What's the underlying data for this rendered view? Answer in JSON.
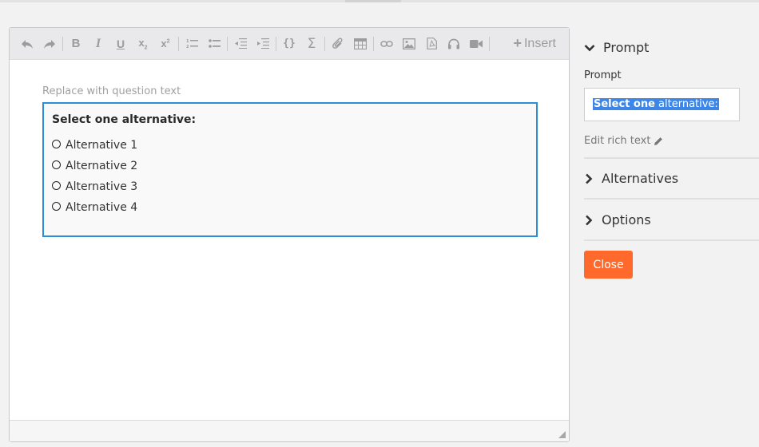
{
  "editor": {
    "toolbar": {
      "items": [
        "undo-icon",
        "redo-icon",
        "|",
        "bold-icon",
        "italic-icon",
        "underline-icon",
        "subscript-icon",
        "superscript-icon",
        "|",
        "ordered-list-icon",
        "unordered-list-icon",
        "|",
        "outdent-icon",
        "indent-icon",
        "|",
        "code-icon",
        "sigma-icon",
        "|",
        "attachment-icon",
        "table-icon",
        "|",
        "link-icon",
        "image-icon",
        "pdf-icon",
        "audio-icon",
        "video-icon",
        "|"
      ],
      "insert_label": "Insert"
    },
    "placeholder": "Replace with question text",
    "question": {
      "prompt": "Select one alternative:",
      "alternatives": [
        "Alternative 1",
        "Alternative 2",
        "Alternative 3",
        "Alternative 4"
      ]
    }
  },
  "panel": {
    "prompt_section": {
      "title": "Prompt",
      "field_label": "Prompt",
      "field_value_bold": "Select one",
      "field_value_rest": " alternative:",
      "edit_rich_text": "Edit rich text"
    },
    "alternatives_section": {
      "title": "Alternatives"
    },
    "options_section": {
      "title": "Options"
    },
    "close_label": "Close"
  },
  "colors": {
    "accent_blue": "#2b8fd6",
    "selection": "#3b86e8",
    "close_button": "#ff6a2c"
  }
}
